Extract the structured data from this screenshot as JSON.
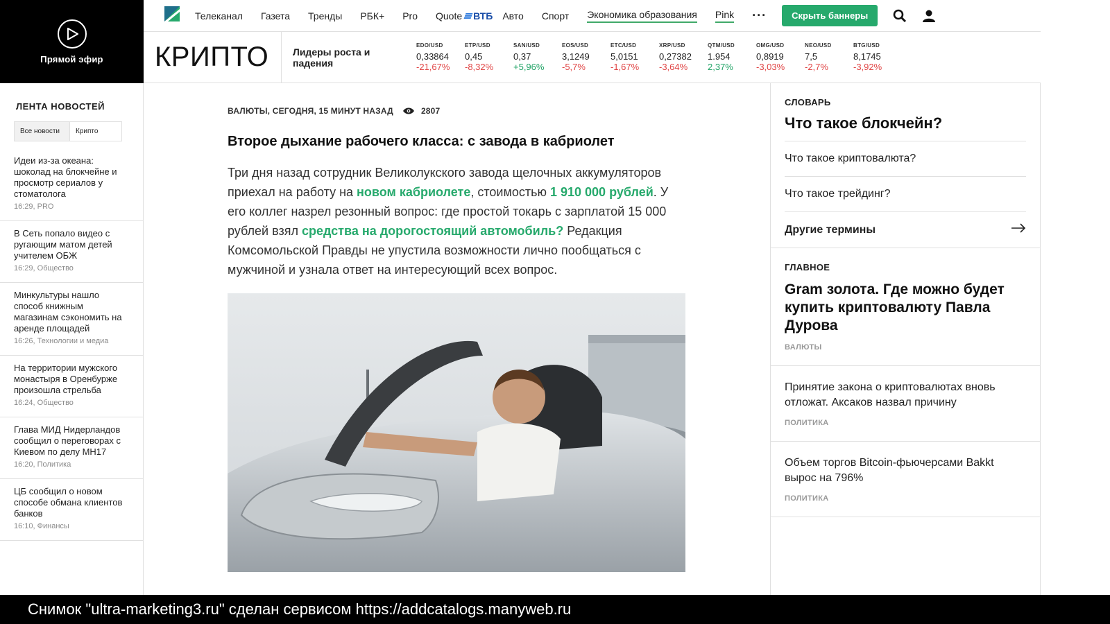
{
  "live": {
    "label": "Прямой эфир",
    "icon": "play-icon"
  },
  "nav": {
    "items": [
      {
        "label": "Телеканал",
        "underline": false
      },
      {
        "label": "Газета",
        "underline": false
      },
      {
        "label": "Тренды",
        "underline": false
      },
      {
        "label": "РБК+",
        "underline": false
      },
      {
        "label": "Pro",
        "underline": false
      }
    ],
    "quote_label": "Quote",
    "vtb_label": "ВТБ",
    "items_after": [
      {
        "label": "Авто",
        "underline": false
      },
      {
        "label": "Спорт",
        "underline": false
      },
      {
        "label": "Экономика образования",
        "underline": true
      },
      {
        "label": "Pink",
        "underline": true
      }
    ],
    "more": "···",
    "hide_banners": "Скрыть баннеры",
    "search_icon": "search-icon",
    "user_icon": "user-icon"
  },
  "crypto": {
    "section_title": "КРИПТО",
    "leaders_label": "Лидеры роста и падения",
    "tickers": [
      {
        "pair": "EDO/USD",
        "price": "0,33864",
        "change": "-21,67%",
        "dir": "neg"
      },
      {
        "pair": "ETP/USD",
        "price": "0,45",
        "change": "-8,32%",
        "dir": "neg"
      },
      {
        "pair": "SAN/USD",
        "price": "0,37",
        "change": "+5,96%",
        "dir": "pos"
      },
      {
        "pair": "EOS/USD",
        "price": "3,1249",
        "change": "-5,7%",
        "dir": "neg"
      },
      {
        "pair": "ETC/USD",
        "price": "5,0151",
        "change": "-1,67%",
        "dir": "neg"
      },
      {
        "pair": "XRP/USD",
        "price": "0,27382",
        "change": "-3,64%",
        "dir": "neg"
      },
      {
        "pair": "QTM/USD",
        "price": "1.954",
        "change": "2,37%",
        "dir": "pos"
      },
      {
        "pair": "OMG/USD",
        "price": "0,8919",
        "change": "-3,03%",
        "dir": "neg"
      },
      {
        "pair": "NEO/USD",
        "price": "7,5",
        "change": "-2,7%",
        "dir": "neg"
      },
      {
        "pair": "BTG/USD",
        "price": "8,1745",
        "change": "-3,92%",
        "dir": "neg"
      }
    ]
  },
  "sidebar": {
    "title": "ЛЕНТА НОВОСТЕЙ",
    "tabs": [
      "Все новости",
      "Крипто"
    ],
    "items": [
      {
        "title": "Идеи из-за океана: шоколад на блокчейне и просмотр сериалов у стоматолога",
        "meta": "16:29, PRO"
      },
      {
        "title": "В Сеть попало видео с ругающим матом детей учителем ОБЖ",
        "meta": "16:29, Общество"
      },
      {
        "title": "Минкультуры нашло способ книжным магазинам сэкономить на аренде площадей",
        "meta": "16:26, Технологии и медиа"
      },
      {
        "title": "На территории мужского монастыря в Оренбурже произошла стрельба",
        "meta": "16:24, Общество"
      },
      {
        "title": "Глава МИД Нидерландов сообщил о переговорах с Киевом по делу MH17",
        "meta": "16:20, Политика"
      },
      {
        "title": "ЦБ сообщил о новом способе обмана клиентов банков",
        "meta": "16:10, Финансы"
      }
    ]
  },
  "article": {
    "meta": "ВАЛЮТЫ, СЕГОДНЯ, 15 МИНУТ НАЗАД",
    "views": "2807",
    "title": "Второе дыхание рабочего класса: с завода в кабриолет",
    "lead_1": "Три дня назад сотрудник Великолукского завода щелочных аккумуляторов приехал на работу на ",
    "link_1": "новом кабриолете",
    "lead_2": ", стоимостью ",
    "link_2": "1 910 000 рублей",
    "lead_3": ". У его коллег назрел резонный вопрос: где простой токарь с зарплатой 15 000 рублей взял ",
    "link_3": "средства на дорогостоящий автомобиль?",
    "lead_4": " Редакция Комсомольской Правды не упустила возможности лично пообщаться с мужчиной и узнала ответ на интересующий всех вопрос."
  },
  "dictionary": {
    "kicker": "СЛОВАРЬ",
    "headline": "Что такое блокчейн?",
    "terms": [
      "Что такое криптовалюта?",
      "Что такое трейдинг?"
    ],
    "other": "Другие термины"
  },
  "main_news": {
    "kicker": "ГЛАВНОЕ",
    "headline": "Gram золота. Где можно будет купить криптовалюту Павла Дурова",
    "headline_rubric": "ВАЛЮТЫ",
    "stories": [
      {
        "title": "Принятие закона о криптовалютах вновь отложат. Аксаков назвал причину",
        "rubric": "ПОЛИТИКА"
      },
      {
        "title": "Объем торгов Bitcoin-фьючерсами Bakkt вырос на 796%",
        "rubric": "ПОЛИТИКА"
      }
    ]
  },
  "caption": "Снимок \"ultra-marketing3.ru\" сделан сервисом https://addcatalogs.manyweb.ru"
}
